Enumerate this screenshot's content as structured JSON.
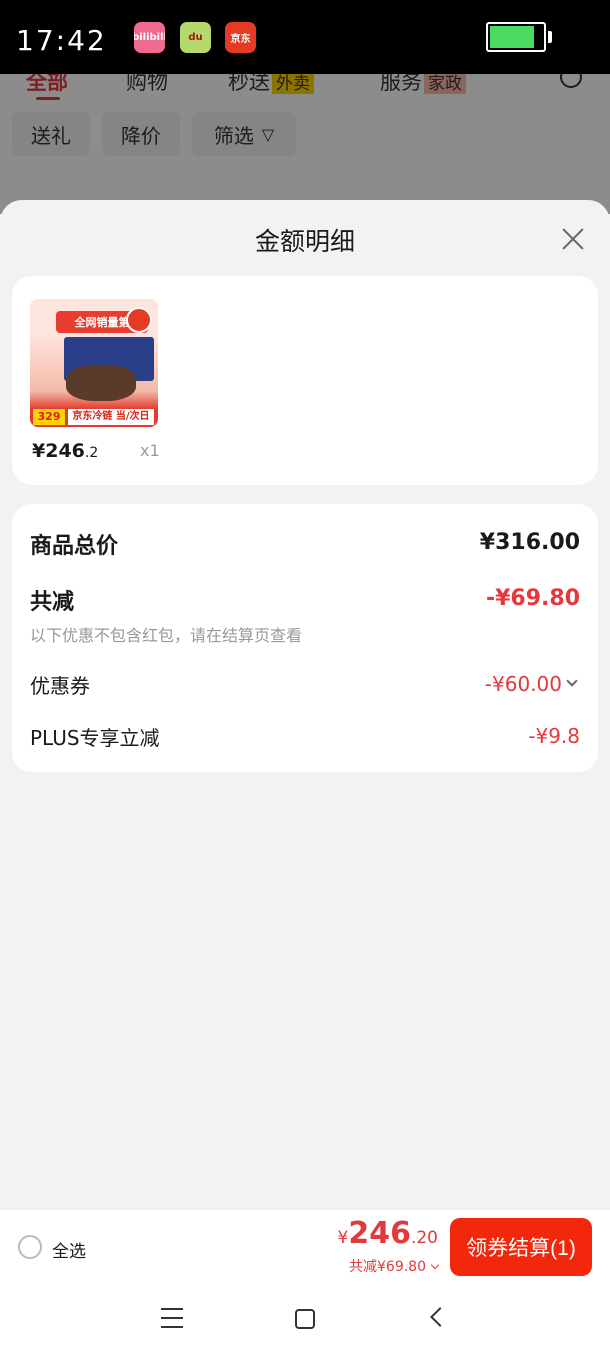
{
  "status_bar": {
    "time": "17:42",
    "app_icons": [
      "bilibili-icon",
      "du-icon",
      "jd-icon"
    ],
    "app_icon_labels": [
      "bilibili",
      "du",
      "京东"
    ],
    "battery_level": 0.85
  },
  "background_page": {
    "tabs": [
      {
        "label": "全部",
        "tag": ""
      },
      {
        "label": "购物",
        "tag": ""
      },
      {
        "label": "秒送",
        "tag": "外卖"
      },
      {
        "label": "服务",
        "tag": "家政"
      }
    ],
    "filters": [
      "送礼",
      "降价",
      "筛选"
    ]
  },
  "sheet": {
    "title": "金额明细",
    "product": {
      "thumb_banner": "全网销量第",
      "thumb_price": "329",
      "thumb_cold_chain": "京东冷链 当/次日达",
      "price_symbol": "¥",
      "price_int": "246",
      "price_dec": ".2",
      "quantity": "x1"
    },
    "details": {
      "goods_total_label": "商品总价",
      "goods_total_value": "¥316.00",
      "total_reduce_label": "共减",
      "total_reduce_value": "-¥69.80",
      "note": "以下优惠不包含红包，请在结算页查看",
      "coupon_label": "优惠券",
      "coupon_value": "-¥60.00",
      "plus_label": "PLUS专享立减",
      "plus_value": "-¥9.8"
    }
  },
  "checkout": {
    "select_all_label": "全选",
    "total_symbol": "¥",
    "total_int": "246",
    "total_dec": ".20",
    "reduce_text": "共减¥69.80",
    "button_label": "领券结算(1)"
  },
  "colors": {
    "accent_red": "#e4393c",
    "button_red": "#f2270c",
    "background": "#f2f2f2"
  }
}
